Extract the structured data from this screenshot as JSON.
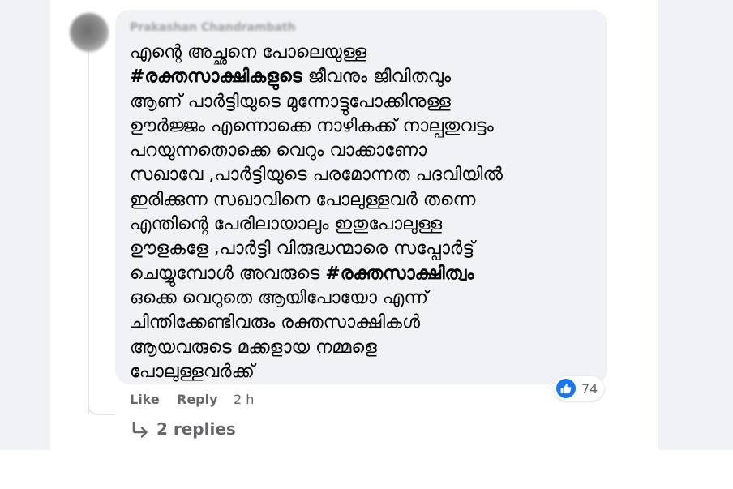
{
  "comment": {
    "author": "Prakashan Chandrambath",
    "lines": [
      {
        "parts": [
          {
            "t": "എന്റെ അച്ഛനെ പോലെയുള്ള",
            "b": false
          }
        ]
      },
      {
        "parts": [
          {
            "t": "#രക്തസാക്ഷികളുടെ",
            "b": true
          },
          {
            "t": " ജീവനും ജീവിതവും",
            "b": false
          }
        ]
      },
      {
        "parts": [
          {
            "t": "ആണ് പാർട്ടിയുടെ മുന്നോട്ടുപോക്കിനുള്ള",
            "b": false
          }
        ]
      },
      {
        "parts": [
          {
            "t": "ഊർജ്ജം എന്നൊക്കെ നാഴികക്ക് നാല്പതുവട്ടം",
            "b": false
          }
        ]
      },
      {
        "parts": [
          {
            "t": "പറയുന്നതൊക്കെ വെറും വാക്കാണോ",
            "b": false
          }
        ]
      },
      {
        "parts": [
          {
            "t": "സഖാവേ ,പാർട്ടിയുടെ പരമോന്നത പദവിയിൽ",
            "b": false
          }
        ]
      },
      {
        "parts": [
          {
            "t": "ഇരിക്കുന്ന സഖാവിനെ പോലുള്ളവർ തന്നെ",
            "b": false
          }
        ]
      },
      {
        "parts": [
          {
            "t": "എന്തിന്റെ പേരിലായാലും ഇതുപോലുള്ള",
            "b": false
          }
        ]
      },
      {
        "parts": [
          {
            "t": "ഊളകളേ ,പാർട്ടി വിരുദ്ധന്മാരെ സപ്പോർട്ട്",
            "b": false
          }
        ]
      },
      {
        "parts": [
          {
            "t": "ചെയ്യുമ്പോൾ അവരുടെ ",
            "b": false
          },
          {
            "t": "#രക്തസാക്ഷിത്വം",
            "b": true
          }
        ]
      },
      {
        "parts": [
          {
            "t": "ഒക്കെ വെറുതെ ആയിപോയോ എന്ന്",
            "b": false
          }
        ]
      },
      {
        "parts": [
          {
            "t": "ചിന്തിക്കേണ്ടിവരും രക്തസാക്ഷികൾ",
            "b": false
          }
        ]
      },
      {
        "parts": [
          {
            "t": "ആയവരുടെ മക്കളായ നമ്മളെ",
            "b": false
          }
        ]
      },
      {
        "parts": [
          {
            "t": "പോലുള്ളവർക്ക്",
            "b": false
          }
        ]
      }
    ]
  },
  "reactions": {
    "icon": "like-icon",
    "count": "74",
    "color": "#1877f2"
  },
  "actions": {
    "like": "Like",
    "reply": "Reply",
    "time": "2 h"
  },
  "replies": {
    "icon": "reply-arrow-icon",
    "label": "2 replies"
  }
}
